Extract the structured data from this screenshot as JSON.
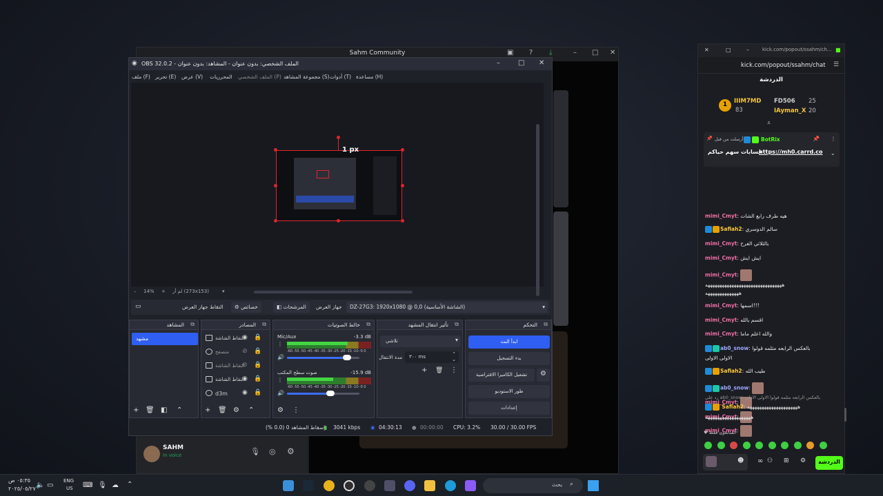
{
  "discord": {
    "title": "Sahm Community",
    "user_name": "SAHM",
    "user_status": "In voice"
  },
  "obs": {
    "title": "OBS 32.0.2 - الملف الشخصي: بدون عنوان - المشاهد: بدون عنوان",
    "menu": [
      "ملف (F)",
      "تحرير (E)",
      "عرض (V)",
      "المحرريات",
      "الملف الشخصي (P)",
      "مجموعة المشاهد (S)",
      "أدوات (T)",
      "مساعدة (H)"
    ],
    "px_label": "1 px",
    "zoom": {
      "percent": "14%",
      "info": "لم أر (273x153)"
    },
    "source_bar": {
      "device_label": "جهاز العرض",
      "device_value": "DZ-27G3: 1920x1080 @ 0,0 (الشاشة الأساسية)",
      "filters": "المرشحات",
      "properties": "خصائص",
      "capture_name": "التقاط جهاز العرض"
    },
    "docks": {
      "scenes": {
        "title": "المشاهد",
        "item": "مشهد"
      },
      "sources": {
        "title": "المصادر",
        "items": [
          {
            "name": "التقاط الشاشة"
          },
          {
            "name": "متصفح"
          },
          {
            "name": "التقاط الشاشة"
          },
          {
            "name": "التقاط الشاشة"
          },
          {
            "name": "d3m"
          }
        ]
      },
      "mixer": {
        "title": "خالط الصوتيات",
        "channels": [
          {
            "name": "Mic/Aux",
            "db": "-3.3 dB",
            "level": 0.72,
            "vol": 0.83
          },
          {
            "name": "صوت سطح المكتب",
            "db": "-15.9 dB",
            "level": 0.55,
            "vol": 0.6
          }
        ],
        "ticks": "-60 -55 -50 -45 -40 -35 -30 -25 -20 -15 -10 -5 0"
      },
      "transitions": {
        "title": "تأثير انتقال المشهد",
        "type": "تلاشي",
        "duration_label": "مدة الانتقال",
        "duration_value": "٣٠٠ ms"
      },
      "controls": {
        "title": "التحكم",
        "buttons": [
          "ابدأ البث",
          "بدء التسجيل",
          "تشغيل الكاميرا الافتراضية",
          "طور الاستوديو",
          "إعدادات"
        ]
      }
    },
    "status": {
      "dropped": "إسقاط المشاهد 0 (0.0 %)",
      "bitrate": "3041 kbps",
      "stream_time": "04:30:13",
      "rec_time": "00:00:00",
      "cpu": "CPU: 3.2%",
      "fps": "30.00 / 30.00 FPS"
    }
  },
  "kick": {
    "url_short": "kick.com/popout/ssahm/ch...",
    "url": "kick.com/popout/ssahm/chat",
    "title": "الدردشة",
    "leaderboard": [
      {
        "name": "IIIM7MD",
        "count": "83"
      },
      {
        "name": "FD506",
        "count": "25"
      },
      {
        "name": "IAyman_X",
        "count": "20"
      }
    ],
    "rank": "1",
    "pinned": {
      "by": "BotRix",
      "note": "أرسلت من قبل",
      "text": "حسابات سهم حياكم",
      "link": "https://mh0.carrd.co"
    },
    "messages": [
      {
        "user": "mimi_Cmyt",
        "cls": "u-mimi",
        "badges": [],
        "text": "هيه طرف رابع الشات"
      },
      {
        "user": "Safiah2",
        "cls": "u-saf",
        "badges": [
          "b-blue",
          "b-gold"
        ],
        "text": "سالم الدوسري"
      },
      {
        "user": "mimi_Cmyt",
        "cls": "u-mimi",
        "badges": [],
        "text": "بالثلاثي الفرح"
      },
      {
        "user": "mimi_Cmyt",
        "cls": "u-mimi",
        "badges": [],
        "text": "ايش ايش"
      },
      {
        "user": "mimi_Cmyt",
        "cls": "u-mimi",
        "badges": [],
        "text": ""
      },
      {
        "user": "",
        "cls": "",
        "badges": [],
        "text": "ههههههههههههههههههههههههههههههههه"
      },
      {
        "user": "",
        "cls": "",
        "badges": [],
        "text": "ههههههههههههههه"
      },
      {
        "user": "mimi_Cmyt",
        "cls": "u-mimi",
        "badges": [],
        "text": "اسمها!!!"
      },
      {
        "user": "mimi_Cmyt",
        "cls": "u-mimi",
        "badges": [],
        "text": "اقسم بالله"
      },
      {
        "user": "mimi_Cmyt",
        "cls": "u-mimi",
        "badges": [],
        "text": "والله اعلم ماما"
      },
      {
        "user": "ab0_snow",
        "cls": "u-ab0",
        "badges": [
          "b-blue",
          "b-cyan"
        ],
        "text": "بالعكس الرابعه مثلمه قولوا"
      },
      {
        "user": "",
        "cls": "",
        "badges": [],
        "text": "الاولى الاولى"
      },
      {
        "user": "Safiah2",
        "cls": "u-saf",
        "badges": [
          "b-blue",
          "b-gold"
        ],
        "text": "طيب الله"
      },
      {
        "user": "ab0_snow",
        "cls": "u-ab0",
        "badges": [
          "b-blue",
          "b-cyan"
        ],
        "text": ""
      },
      {
        "user": "mimi_Cmyt",
        "cls": "u-mimi",
        "badges": [],
        "text": ""
      },
      {
        "user": "mimi_Cmyt",
        "cls": "u-mimi",
        "badges": [],
        "text": ""
      },
      {
        "user": "mimi_Cmyt",
        "cls": "u-mimi",
        "badges": [],
        "text": ""
      }
    ],
    "reply_note": "رد على ab0_snow: بالعكس الرابعه مثلمه قولوا الاولى الاولى",
    "last_msg": {
      "user": "Safiah2",
      "text": "هههههههههههههههههههههه"
    },
    "last_msg2": "هههههههههههههههههههه",
    "quick_note": "المتابعون فقط",
    "send_label": "الدردشة"
  },
  "taskbar": {
    "time": "٠٥:٣٥ ص",
    "date": "٢٠٢٥/٠٥/٢٧",
    "lang": "ENG",
    "region": "US",
    "search_placeholder": "بحث"
  }
}
